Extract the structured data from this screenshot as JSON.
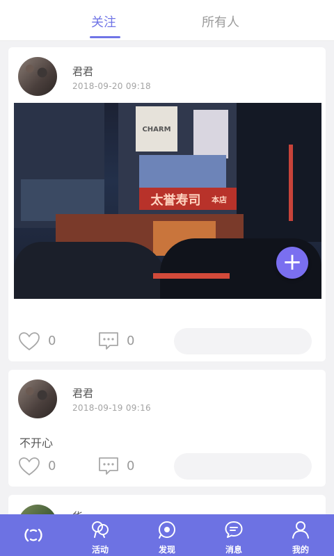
{
  "tabs": [
    {
      "label": "关注",
      "active": true
    },
    {
      "label": "所有人",
      "active": false
    }
  ],
  "posts": [
    {
      "username": "君君",
      "time": "2018-09-20 09:18",
      "likes": "0",
      "comments": "0",
      "photo_signs": [
        "CHARM",
        "太誉寿司",
        "本店"
      ]
    },
    {
      "username": "君君",
      "time": "2018-09-19 09:16",
      "text": "不开心",
      "likes": "0",
      "comments": "0"
    }
  ],
  "partial_post": {
    "username_fragment": "华"
  },
  "fab": {
    "symbol": "+"
  },
  "bottom_nav": [
    {
      "label": "",
      "icon": "home-icon"
    },
    {
      "label": "活动",
      "icon": "activity-icon"
    },
    {
      "label": "发现",
      "icon": "discover-icon"
    },
    {
      "label": "消息",
      "icon": "message-icon"
    },
    {
      "label": "我的",
      "icon": "profile-icon"
    }
  ],
  "colors": {
    "accent": "#6f74e6",
    "bottom_bar": "#6d72e3",
    "fab": "#7a6ff0"
  }
}
